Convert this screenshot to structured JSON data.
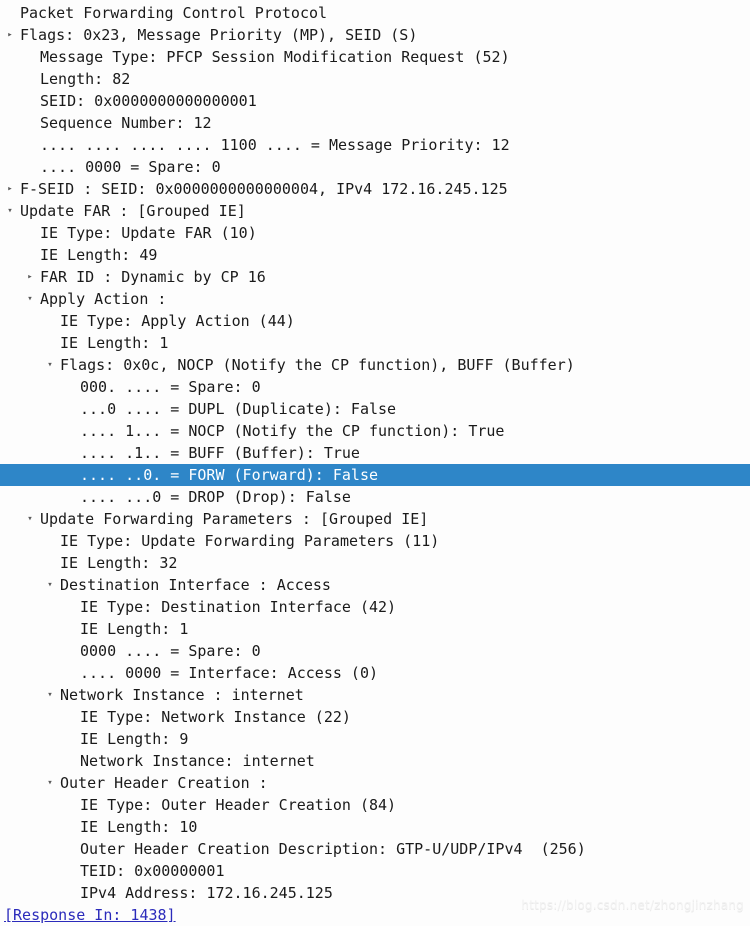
{
  "window": {
    "title": "Packet Forwarding Control Protocol",
    "background_color": "#fdfdfd",
    "selection_color": "#2e86c8",
    "selection_text_color": "#ffffff",
    "link_color": "#2b2bbb",
    "text_color": "#1a1a1a"
  },
  "icons": {
    "collapsed": "▸",
    "expanded": "▾",
    "none": ""
  },
  "watermark": {
    "text": "https://blog.csdn.net/zhongjinzhang"
  },
  "tree": {
    "rows": [
      {
        "indent": 0,
        "marker": "none",
        "text": "Packet Forwarding Control Protocol",
        "state": "normal"
      },
      {
        "indent": 0,
        "marker": "collapsed",
        "text": "Flags: 0x23, Message Priority (MP), SEID (S)",
        "state": "normal"
      },
      {
        "indent": 1,
        "marker": "none",
        "text": "Message Type: PFCP Session Modification Request (52)",
        "state": "normal"
      },
      {
        "indent": 1,
        "marker": "none",
        "text": "Length: 82",
        "state": "normal"
      },
      {
        "indent": 1,
        "marker": "none",
        "text": "SEID: 0x0000000000000001",
        "state": "normal"
      },
      {
        "indent": 1,
        "marker": "none",
        "text": "Sequence Number: 12",
        "state": "normal"
      },
      {
        "indent": 1,
        "marker": "none",
        "text": ".... .... .... .... 1100 .... = Message Priority: 12",
        "state": "normal"
      },
      {
        "indent": 1,
        "marker": "none",
        "text": ".... 0000 = Spare: 0",
        "state": "normal"
      },
      {
        "indent": 0,
        "marker": "collapsed",
        "text": "F-SEID : SEID: 0x0000000000000004, IPv4 172.16.245.125",
        "state": "normal"
      },
      {
        "indent": 0,
        "marker": "expanded",
        "text": "Update FAR : [Grouped IE]",
        "state": "normal"
      },
      {
        "indent": 1,
        "marker": "none",
        "text": "IE Type: Update FAR (10)",
        "state": "normal"
      },
      {
        "indent": 1,
        "marker": "none",
        "text": "IE Length: 49",
        "state": "normal"
      },
      {
        "indent": 1,
        "marker": "collapsed",
        "text": "FAR ID : Dynamic by CP 16",
        "state": "normal"
      },
      {
        "indent": 1,
        "marker": "expanded",
        "text": "Apply Action :",
        "state": "normal"
      },
      {
        "indent": 2,
        "marker": "none",
        "text": "IE Type: Apply Action (44)",
        "state": "normal"
      },
      {
        "indent": 2,
        "marker": "none",
        "text": "IE Length: 1",
        "state": "normal"
      },
      {
        "indent": 2,
        "marker": "expanded",
        "text": "Flags: 0x0c, NOCP (Notify the CP function), BUFF (Buffer)",
        "state": "normal"
      },
      {
        "indent": 3,
        "marker": "none",
        "text": "000. .... = Spare: 0",
        "state": "normal"
      },
      {
        "indent": 3,
        "marker": "none",
        "text": "...0 .... = DUPL (Duplicate): False",
        "state": "normal"
      },
      {
        "indent": 3,
        "marker": "none",
        "text": ".... 1... = NOCP (Notify the CP function): True",
        "state": "normal"
      },
      {
        "indent": 3,
        "marker": "none",
        "text": ".... .1.. = BUFF (Buffer): True",
        "state": "normal"
      },
      {
        "indent": 3,
        "marker": "none",
        "text": ".... ..0. = FORW (Forward): False",
        "state": "selected"
      },
      {
        "indent": 3,
        "marker": "none",
        "text": ".... ...0 = DROP (Drop): False",
        "state": "normal"
      },
      {
        "indent": 1,
        "marker": "expanded",
        "text": "Update Forwarding Parameters : [Grouped IE]",
        "state": "normal"
      },
      {
        "indent": 2,
        "marker": "none",
        "text": "IE Type: Update Forwarding Parameters (11)",
        "state": "normal"
      },
      {
        "indent": 2,
        "marker": "none",
        "text": "IE Length: 32",
        "state": "normal"
      },
      {
        "indent": 2,
        "marker": "expanded",
        "text": "Destination Interface : Access",
        "state": "normal"
      },
      {
        "indent": 3,
        "marker": "none",
        "text": "IE Type: Destination Interface (42)",
        "state": "normal"
      },
      {
        "indent": 3,
        "marker": "none",
        "text": "IE Length: 1",
        "state": "normal"
      },
      {
        "indent": 3,
        "marker": "none",
        "text": "0000 .... = Spare: 0",
        "state": "normal"
      },
      {
        "indent": 3,
        "marker": "none",
        "text": ".... 0000 = Interface: Access (0)",
        "state": "normal"
      },
      {
        "indent": 2,
        "marker": "expanded",
        "text": "Network Instance : internet",
        "state": "normal"
      },
      {
        "indent": 3,
        "marker": "none",
        "text": "IE Type: Network Instance (22)",
        "state": "normal"
      },
      {
        "indent": 3,
        "marker": "none",
        "text": "IE Length: 9",
        "state": "normal"
      },
      {
        "indent": 3,
        "marker": "none",
        "text": "Network Instance: internet",
        "state": "normal"
      },
      {
        "indent": 2,
        "marker": "expanded",
        "text": "Outer Header Creation :",
        "state": "normal"
      },
      {
        "indent": 3,
        "marker": "none",
        "text": "IE Type: Outer Header Creation (84)",
        "state": "normal"
      },
      {
        "indent": 3,
        "marker": "none",
        "text": "IE Length: 10",
        "state": "normal"
      },
      {
        "indent": 3,
        "marker": "none",
        "text": "Outer Header Creation Description: GTP-U/UDP/IPv4  (256)",
        "state": "normal"
      },
      {
        "indent": 3,
        "marker": "none",
        "text": "TEID: 0x00000001",
        "state": "normal"
      },
      {
        "indent": 3,
        "marker": "none",
        "text": "IPv4 Address: 172.16.245.125",
        "state": "normal"
      },
      {
        "indent": -1,
        "marker": "none",
        "text": "[Response In: 1438]",
        "state": "link"
      }
    ]
  }
}
